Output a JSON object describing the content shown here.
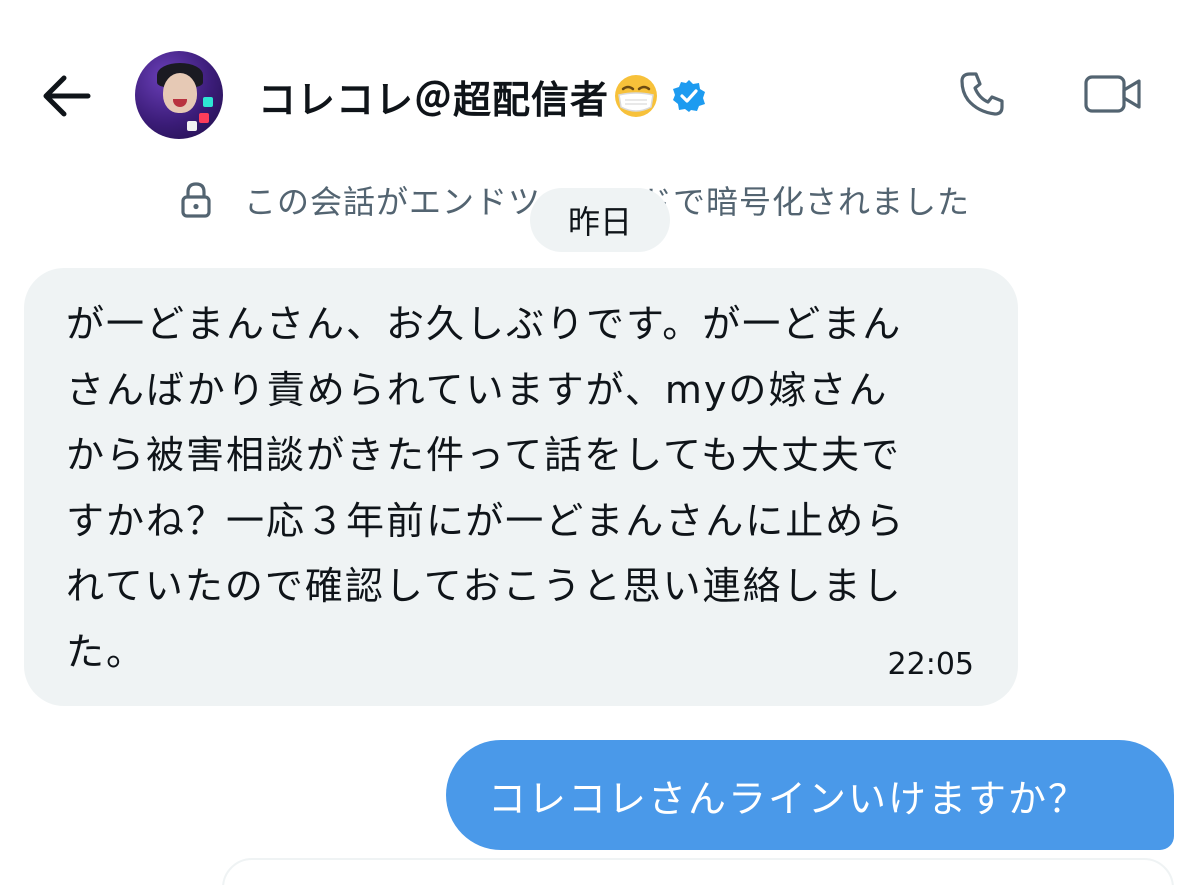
{
  "header": {
    "display_name": "コレコレ＠超配信者",
    "emoji": "face-with-medical-mask-emoji",
    "verified": true
  },
  "conversation": {
    "encryption_notice": "この会話がエンドツーエンドで暗号化されました",
    "date_separator": "昨日"
  },
  "messages": [
    {
      "direction": "incoming",
      "text": "が一どまんさん、お久しぶりです。が一どまん\nさんばかり責められていますが、myの嫁さん\nから被害相談がきた件って話をしても大丈夫で\nすかね？一応３年前にが一どまんさんに止めら\nれていたので確認しておこうと思い連絡しまし\nた。",
      "time": "22:05"
    },
    {
      "direction": "outgoing",
      "text": "コレコレさんラインいけますか？"
    }
  ],
  "colors": {
    "incoming_bubble": "#eff3f4",
    "outgoing_bubble": "#4a99e9",
    "verified_blue": "#1d9bf0",
    "muted_text": "#536471"
  }
}
